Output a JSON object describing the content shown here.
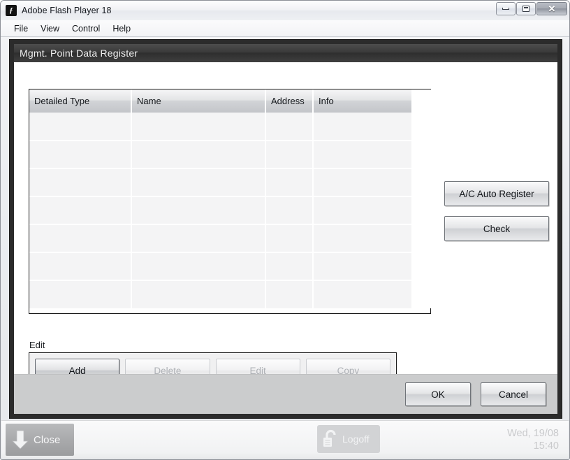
{
  "window": {
    "title": "Adobe Flash Player 18",
    "app_icon": "flash-icon",
    "controls": {
      "minimize": "minimize-icon",
      "maximize": "maximize-icon",
      "close": "✕"
    }
  },
  "menubar": {
    "items": [
      {
        "label": "File"
      },
      {
        "label": "View"
      },
      {
        "label": "Control"
      },
      {
        "label": "Help"
      }
    ]
  },
  "panel": {
    "title": "Mgmt. Point Data Register"
  },
  "table": {
    "columns": [
      {
        "label": "Detailed Type"
      },
      {
        "label": "Name"
      },
      {
        "label": "Address"
      },
      {
        "label": "Info"
      },
      {
        "label": ""
      }
    ],
    "rows": [
      [
        "",
        "",
        "",
        "",
        ""
      ],
      [
        "",
        "",
        "",
        "",
        ""
      ],
      [
        "",
        "",
        "",
        "",
        ""
      ],
      [
        "",
        "",
        "",
        "",
        ""
      ],
      [
        "",
        "",
        "",
        "",
        ""
      ],
      [
        "",
        "",
        "",
        "",
        ""
      ],
      [
        "",
        "",
        "",
        "",
        ""
      ]
    ],
    "row_count": 7
  },
  "side_buttons": {
    "auto_register": "A/C Auto Register",
    "check": "Check"
  },
  "edit_section": {
    "label": "Edit",
    "buttons": [
      {
        "label": "Add",
        "enabled": true
      },
      {
        "label": "Delete",
        "enabled": false
      },
      {
        "label": "Edit",
        "enabled": false
      },
      {
        "label": "Copy",
        "enabled": false
      }
    ]
  },
  "footer": {
    "ok_label": "OK",
    "cancel_label": "Cancel"
  },
  "statusbar": {
    "close_label": "Close",
    "close_icon": "arrow-down-icon",
    "logoff_label": "Logoff",
    "logoff_icon": "unlocked-padlock-icon",
    "date": "Wed, 19/08",
    "time": "15:40"
  },
  "colors": {
    "panel_header_dark": "#3a3a3a",
    "stage_border": "#2b2b2b",
    "footer_band": "#cbcccd",
    "button_face": "#e4e5e7",
    "disabled_text": "#aeb1b6"
  }
}
